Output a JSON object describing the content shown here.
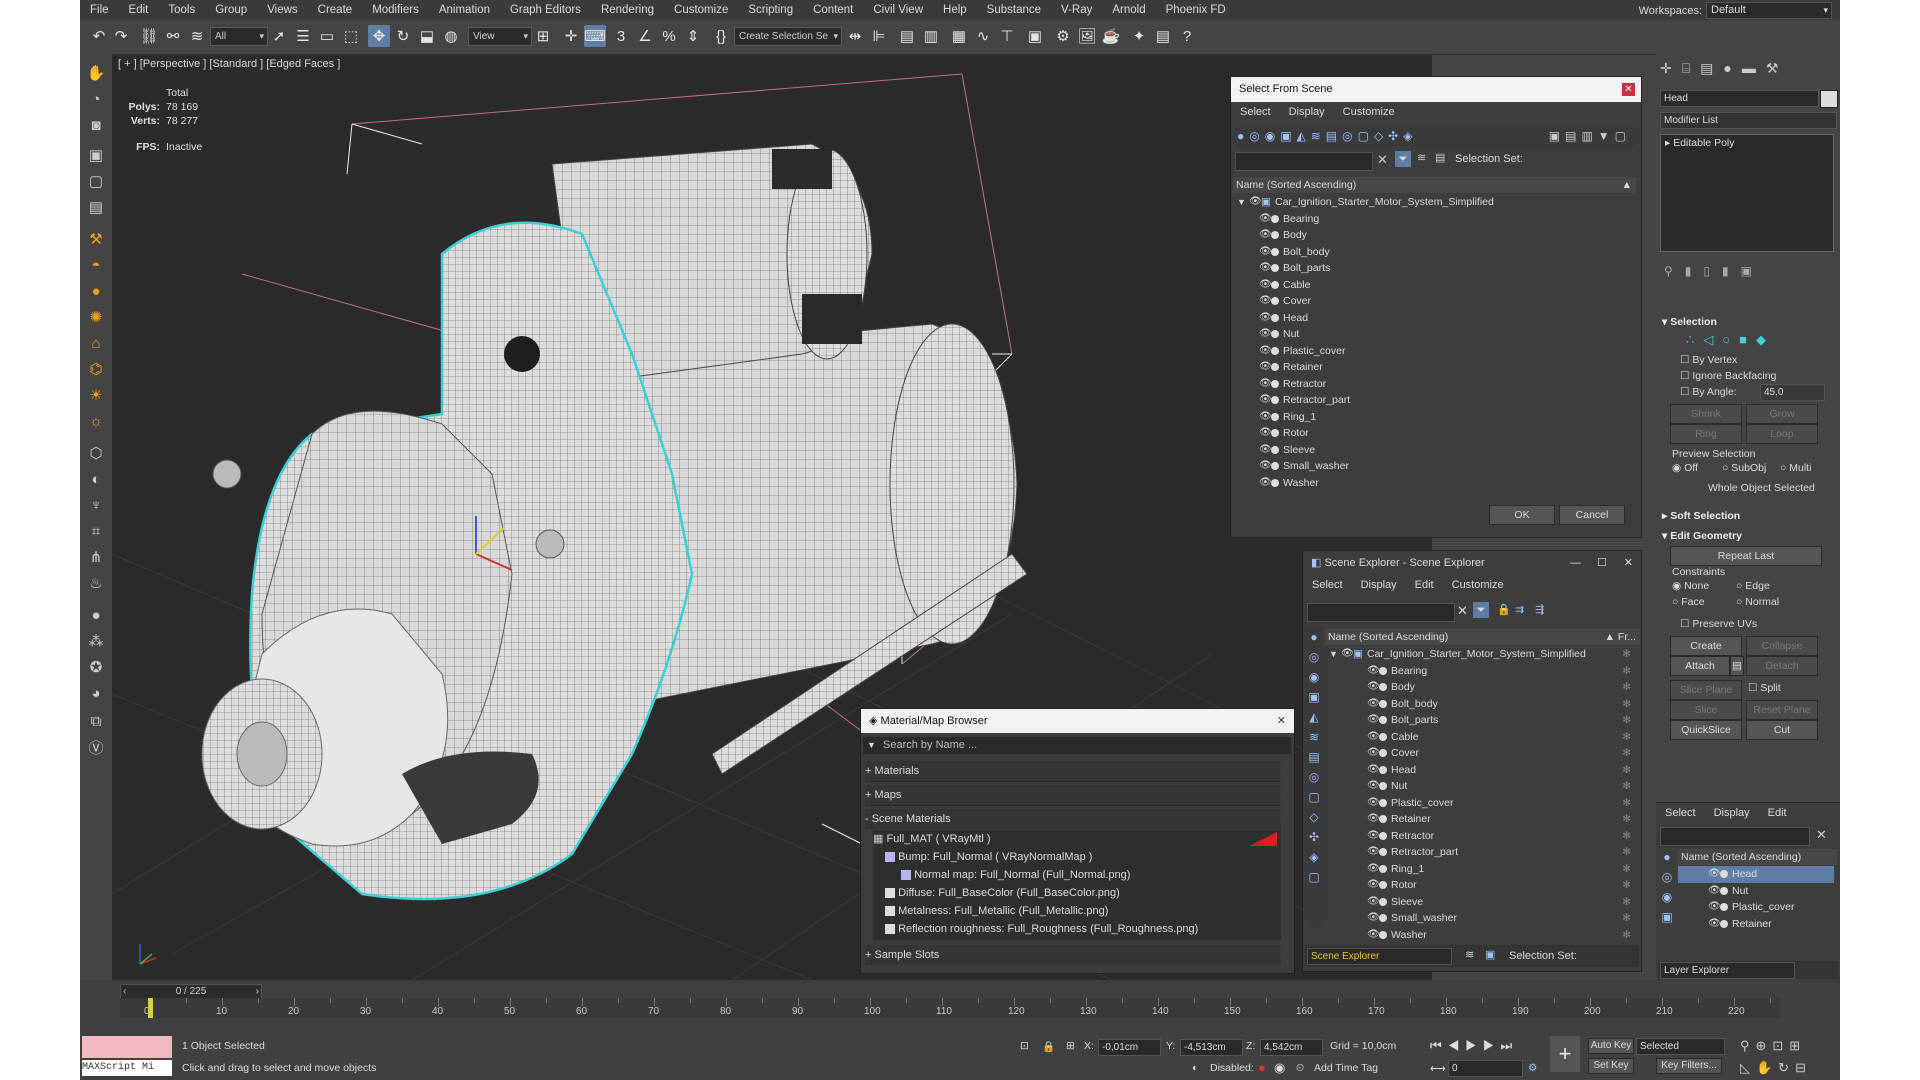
{
  "menu": [
    "File",
    "Edit",
    "Tools",
    "Group",
    "Views",
    "Create",
    "Modifiers",
    "Animation",
    "Graph Editors",
    "Rendering",
    "Customize",
    "Scripting",
    "Content",
    "Civil View",
    "Help",
    "Substance",
    "V-Ray",
    "Arnold",
    "Phoenix FD"
  ],
  "workspaces": {
    "label": "Workspaces:",
    "value": "Default"
  },
  "toolbar": {
    "filter": "All",
    "ref_coord": "View",
    "selection_set": "Create Selection Se"
  },
  "viewport": {
    "label": "[ + ] [Perspective ] [Standard ] [Edged Faces ]",
    "stats": {
      "total": "Total",
      "polys_label": "Polys:",
      "polys": "78 169",
      "verts_label": "Verts:",
      "verts": "78 277",
      "fps_label": "FPS:",
      "fps": "Inactive"
    }
  },
  "select_dialog": {
    "title": "Select From Scene",
    "menu": [
      "Select",
      "Display",
      "Customize"
    ],
    "selection_set": "Selection Set:",
    "column": "Name (Sorted Ascending)",
    "root": "Car_Ignition_Starter_Motor_System_Simplified",
    "items": [
      "Bearing",
      "Body",
      "Bolt_body",
      "Bolt_parts",
      "Cable",
      "Cover",
      "Head",
      "Nut",
      "Plastic_cover",
      "Retainer",
      "Retractor",
      "Retractor_part",
      "Ring_1",
      "Rotor",
      "Sleeve",
      "Small_washer",
      "Washer"
    ],
    "ok": "OK",
    "cancel": "Cancel"
  },
  "scene_explorer": {
    "title": "Scene Explorer - Scene Explorer",
    "menu": [
      "Select",
      "Display",
      "Edit",
      "Customize"
    ],
    "column": "Name (Sorted Ascending)",
    "column2": "▲ Fr...",
    "root": "Car_Ignition_Starter_Motor_System_Simplified",
    "items": [
      "Bearing",
      "Body",
      "Bolt_body",
      "Bolt_parts",
      "Cable",
      "Cover",
      "Head",
      "Nut",
      "Plastic_cover",
      "Retainer",
      "Retractor",
      "Retractor_part",
      "Ring_1",
      "Rotor",
      "Sleeve",
      "Small_washer",
      "Washer"
    ],
    "footer_select": "Scene Explorer",
    "selection_set": "Selection Set:"
  },
  "material_browser": {
    "title": "Material/Map Browser",
    "search": "Search by Name ...",
    "materials": "+ Materials",
    "maps": "+ Maps",
    "scene_materials": "- Scene Materials",
    "entries": [
      "Full_MAT  ( VRayMtl )",
      "Bump: Full_Normal  ( VRayNormalMap )",
      "Normal map: Full_Normal (Full_Normal.png)",
      "Diffuse: Full_BaseColor (Full_BaseColor.png)",
      "Metalness: Full_Metallic (Full_Metallic.png)",
      "Reflection roughness: Full_Roughness (Full_Roughness.png)"
    ],
    "sample_slots": "+ Sample Slots"
  },
  "command_panel": {
    "object_name": "Head",
    "modifier_list": "Modifier List",
    "stack_item": "Editable Poly",
    "selection": "Selection",
    "by_vertex": "By Vertex",
    "ignore_backfacing": "Ignore Backfacing",
    "by_angle": "By Angle:",
    "angle_value": "45,0",
    "shrink": "Shrink",
    "grow": "Grow",
    "ring": "Ring",
    "loop": "Loop",
    "preview_selection": "Preview Selection",
    "off": "Off",
    "subobj": "SubObj",
    "multi": "Multi",
    "whole_object": "Whole Object Selected",
    "soft_selection": "Soft Selection",
    "edit_geometry": "Edit Geometry",
    "repeat_last": "Repeat Last",
    "constraints": "Constraints",
    "none": "None",
    "edge": "Edge",
    "face": "Face",
    "normal": "Normal",
    "preserve_uvs": "Preserve UVs",
    "create": "Create",
    "collapse": "Collapse",
    "attach": "Attach",
    "detach": "Detach",
    "slice_plane": "Slice Plane",
    "split": "Split",
    "slice": "Slice",
    "reset_plane": "Reset Plane",
    "quickslice": "QuickSlice",
    "cut": "Cut"
  },
  "layer_panel": {
    "menu": [
      "Select",
      "Display",
      "Edit"
    ],
    "column": "Name (Sorted Ascending)",
    "items": [
      "Head",
      "Nut",
      "Plastic_cover",
      "Retainer"
    ],
    "footer": "Layer Explorer"
  },
  "timeline": {
    "frame": "0 / 225",
    "ticks": [
      "0",
      "10",
      "20",
      "30",
      "40",
      "50",
      "60",
      "70",
      "80",
      "90",
      "100",
      "110",
      "120",
      "130",
      "140",
      "150",
      "160",
      "170",
      "180",
      "190",
      "200",
      "210",
      "220"
    ]
  },
  "status": {
    "maxscript": "MAXScript Mi",
    "selected": "1 Object Selected",
    "hint": "Click and drag to select and move objects",
    "x_label": "X:",
    "x": "-0,01cm",
    "y_label": "Y:",
    "y": "-4,513cm",
    "z_label": "Z:",
    "z": "4,542cm",
    "grid": "Grid = 10,0cm",
    "disabled": "Disabled:",
    "add_time_tag": "Add Time Tag",
    "auto_key": "Auto Key",
    "selected_dd": "Selected",
    "set_key": "Set Key",
    "key_filters": "Key Filters...",
    "frame_field": "0"
  }
}
